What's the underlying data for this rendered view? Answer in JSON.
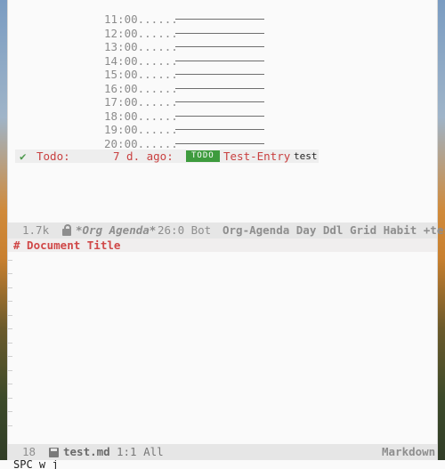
{
  "agenda": {
    "time_slots": [
      "11:00......",
      "12:00......",
      "13:00......",
      "14:00......",
      "15:00......",
      "16:00......",
      "17:00......",
      "18:00......",
      "19:00......",
      "20:00......"
    ],
    "todo_item": {
      "check": "✔",
      "category": "Todo:",
      "ago": "7 d. ago:",
      "keyword": "TODO",
      "entry": "Test-Entry",
      "tag": "test"
    }
  },
  "modeline_top": {
    "size": "1.7k",
    "buffer": "*Org Agenda*",
    "position": "26:0 Bot",
    "modes": "Org-Agenda Day Ddl Grid Habit +test"
  },
  "document": {
    "heading": "# Document Title"
  },
  "modeline_bottom": {
    "line_number": "18",
    "filename": "test.md",
    "position": "1:1 All",
    "mode": "Markdown"
  },
  "minibuffer": {
    "text": "SPC w j"
  }
}
